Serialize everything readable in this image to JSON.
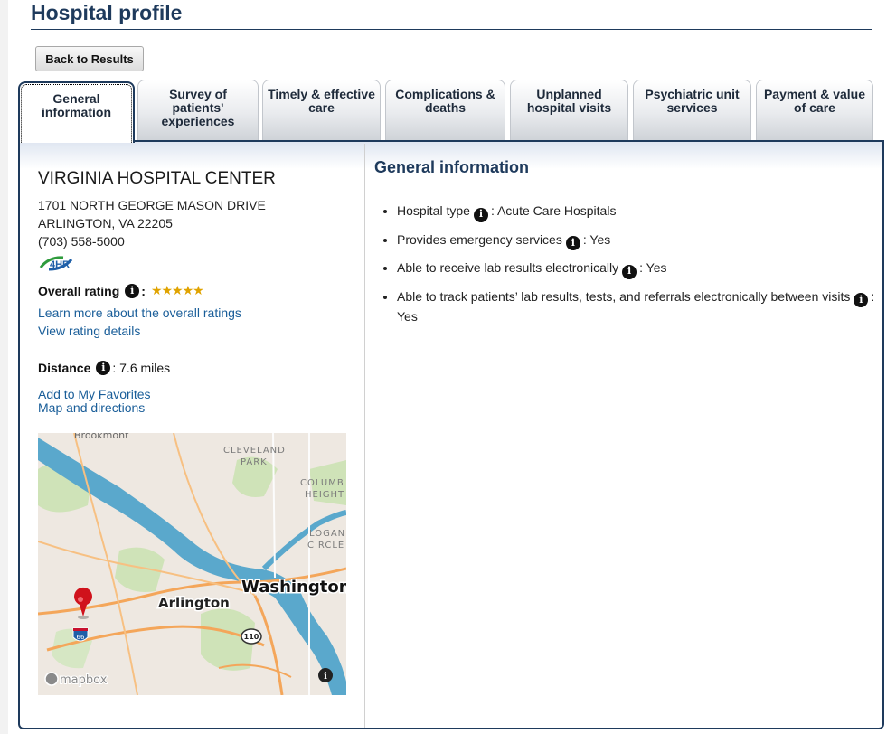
{
  "header": {
    "title": "Hospital profile"
  },
  "back_button": {
    "label": "Back to Results"
  },
  "tabs": [
    {
      "label": "General information",
      "active": true
    },
    {
      "label": "Survey of patients' experiences"
    },
    {
      "label": "Timely & effective care"
    },
    {
      "label": "Complications & deaths"
    },
    {
      "label": "Unplanned hospital visits"
    },
    {
      "label": "Psychiatric unit services"
    },
    {
      "label": "Payment & value of care"
    }
  ],
  "hospital": {
    "name": "VIRGINIA HOSPITAL CENTER",
    "address_line1": "1701 NORTH GEORGE MASON DRIVE",
    "address_line2": "ARLINGTON, VA 22205",
    "phone": "(703) 558-5000",
    "badge_text": "4HR"
  },
  "rating": {
    "label": "Overall rating",
    "stars": 5,
    "stars_display": "★★★★★",
    "learn_more": "Learn more about the overall ratings",
    "details": "View rating details"
  },
  "distance": {
    "label": "Distance",
    "value": ": 7.6 miles"
  },
  "links": {
    "favorites": "Add to My Favorites",
    "directions": "Map and directions"
  },
  "map": {
    "labels": [
      "Brookmont",
      "CLEVELAND",
      "PARK",
      "COLUMB",
      "HEIGHT",
      "LOGAN",
      "CIRCLE",
      "Arlington",
      "Washington"
    ],
    "shields": [
      "66",
      "110"
    ],
    "attribution": "mapbox"
  },
  "general_info": {
    "title": "General information",
    "items": [
      {
        "label": "Hospital type",
        "value": ": Acute Care Hospitals"
      },
      {
        "label": "Provides emergency services",
        "value": ": Yes"
      },
      {
        "label": "Able to receive lab results electronically",
        "value": ": Yes"
      },
      {
        "label": "Able to track patients’ lab results, tests, and referrals electronically between visits",
        "value": ": Yes"
      }
    ]
  },
  "colors": {
    "primary": "#1e3a5c",
    "link": "#1a5e99",
    "star": "#e0a300",
    "pin": "#d0121b",
    "water": "#5aa8cc"
  }
}
